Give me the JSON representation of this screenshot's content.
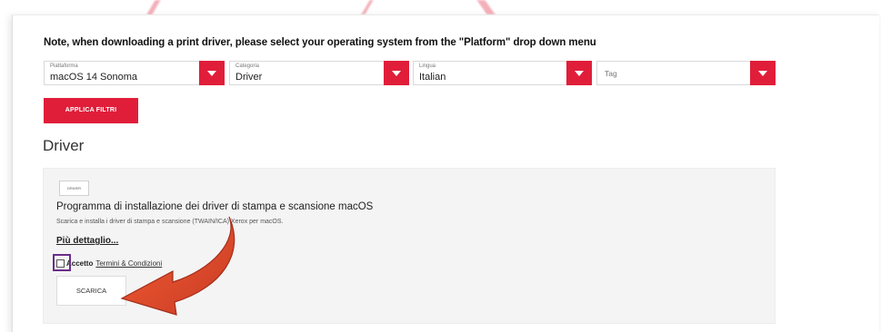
{
  "note": "Note, when downloading a print driver, please select your operating system from the \"Platform\" drop down menu",
  "filters": [
    {
      "label": "Piattaforma",
      "value": "macOS 14 Sonoma"
    },
    {
      "label": "Categoria",
      "value": "Driver"
    },
    {
      "label": "Lingua",
      "value": "Italian"
    },
    {
      "label": "",
      "value": "",
      "placeholder": "Tag"
    }
  ],
  "apply_button": "APPLICA FILTRI",
  "section_title": "Driver",
  "download_item": {
    "tag": "DRIVER",
    "title": "Programma di installazione dei driver di stampa e scansione macOS",
    "description": "Scarica e installa i driver di stampa e scansione (TWAIN/ICA) Xerox per macOS.",
    "more_link": "Più dettaglio...",
    "accept_label": "Accetto",
    "terms_link": "Termini & Condizioni",
    "download_button": "SCARICA"
  },
  "colors": {
    "accent": "#e01e3a",
    "highlight": "#6b2d8a",
    "arrow": "#e2401f"
  },
  "icons": {
    "dropdown": "chevron-down-icon",
    "annotation_arrow": "curved-arrow-icon"
  }
}
